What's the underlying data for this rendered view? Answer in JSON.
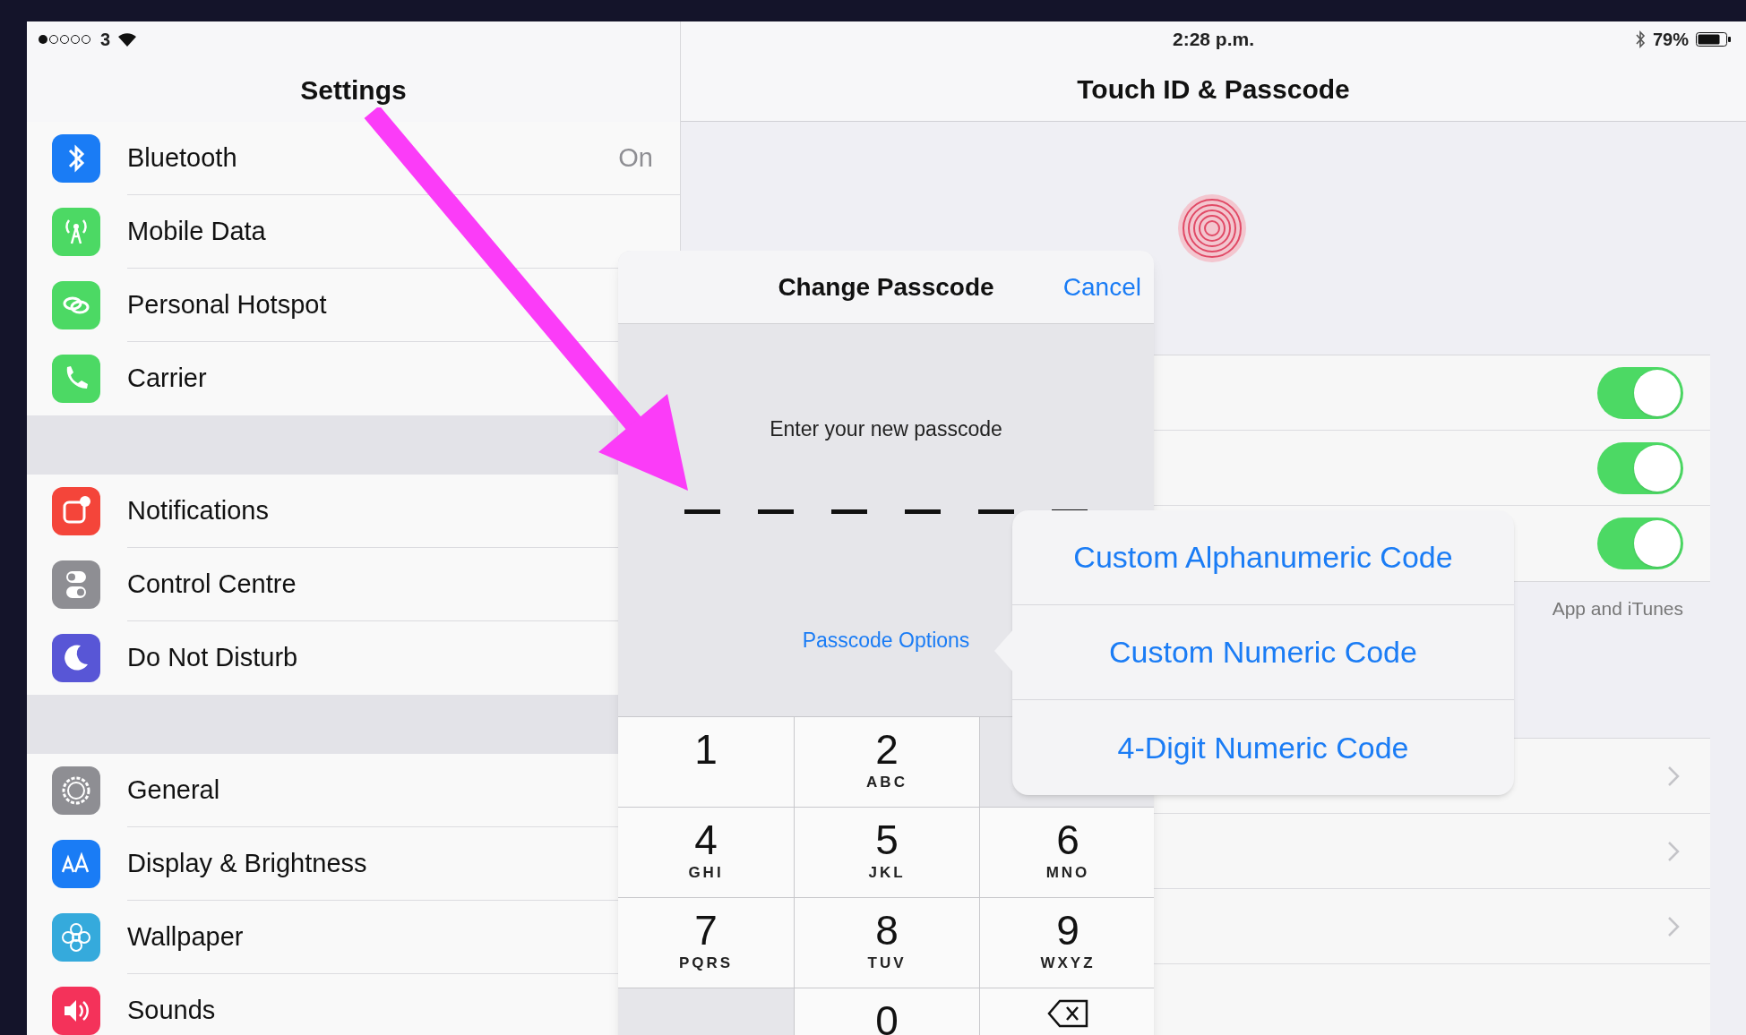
{
  "status_bar": {
    "carrier": "3",
    "time": "2:28 p.m.",
    "battery": "79%"
  },
  "sidebar": {
    "title": "Settings",
    "groups": [
      {
        "items": [
          {
            "label": "Bluetooth",
            "value": "On",
            "color": "#1a7cf5"
          },
          {
            "label": "Mobile Data",
            "color": "#4cd964"
          },
          {
            "label": "Personal Hotspot",
            "color": "#4cd964"
          },
          {
            "label": "Carrier",
            "color": "#4cd964"
          }
        ]
      },
      {
        "items": [
          {
            "label": "Notifications",
            "color": "#f4453a"
          },
          {
            "label": "Control Centre",
            "color": "#8e8e93"
          },
          {
            "label": "Do Not Disturb",
            "color": "#5856d6"
          }
        ]
      },
      {
        "items": [
          {
            "label": "General",
            "color": "#8e8e93"
          },
          {
            "label": "Display & Brightness",
            "color": "#1a7cf5"
          },
          {
            "label": "Wallpaper",
            "color": "#35aadc"
          },
          {
            "label": "Sounds",
            "color": "#f4325a"
          }
        ]
      }
    ]
  },
  "detail": {
    "title": "Touch ID & Passcode",
    "toggles": [
      {
        "on": true
      },
      {
        "on": true
      },
      {
        "on": true
      }
    ],
    "footer": "App and iTunes",
    "links": [
      {
        "kind": "link"
      },
      {
        "kind": "link"
      },
      {
        "kind": "link"
      }
    ]
  },
  "dialog": {
    "title": "Change Passcode",
    "cancel": "Cancel",
    "prompt": "Enter your new passcode",
    "options_link": "Passcode Options",
    "keys": [
      {
        "kind": "digit",
        "digit": "1"
      },
      {
        "kind": "digit",
        "digit": "2",
        "letters": "ABC"
      },
      {
        "kind": "blank"
      },
      {
        "kind": "digit",
        "digit": "4",
        "letters": "GHI"
      },
      {
        "kind": "digit",
        "digit": "5",
        "letters": "JKL"
      },
      {
        "kind": "digit",
        "digit": "6",
        "letters": "MNO"
      },
      {
        "kind": "digit",
        "digit": "7",
        "letters": "PQRS"
      },
      {
        "kind": "digit",
        "digit": "8",
        "letters": "TUV"
      },
      {
        "kind": "digit",
        "digit": "9",
        "letters": "WXYZ"
      },
      {
        "kind": "blank"
      },
      {
        "kind": "digit",
        "digit": "0"
      },
      {
        "kind": "delete"
      }
    ]
  },
  "options_menu": [
    "Custom Alphanumeric Code",
    "Custom Numeric Code",
    "4-Digit Numeric Code"
  ]
}
